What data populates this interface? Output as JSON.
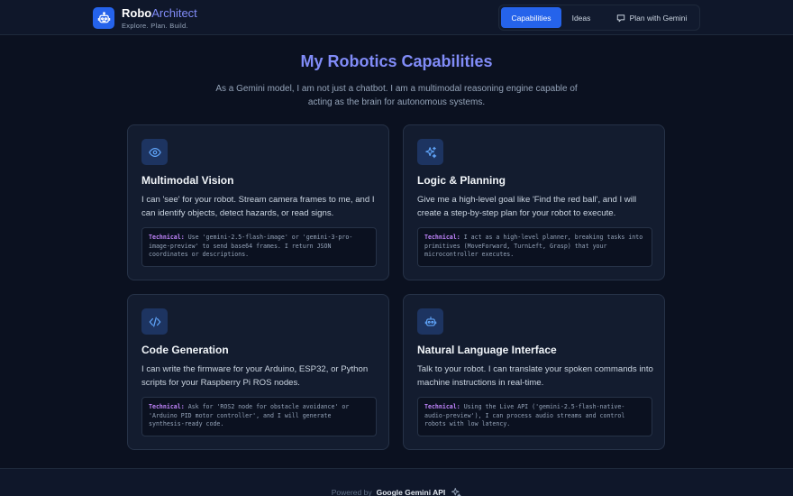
{
  "brand": {
    "name_primary": "Robo",
    "name_secondary": "Architect",
    "tagline": "Explore. Plan. Build."
  },
  "nav": {
    "items": [
      {
        "label": "Capabilities",
        "active": true
      },
      {
        "label": "Ideas",
        "active": false
      },
      {
        "label": "Plan with Gemini",
        "active": false,
        "icon": "chat-icon"
      }
    ]
  },
  "hero": {
    "title": "My Robotics Capabilities",
    "subtitle": "As a Gemini model, I am not just a chatbot. I am a multimodal reasoning engine capable of acting as the brain for autonomous systems."
  },
  "cards": [
    {
      "icon": "eye-icon",
      "title": "Multimodal Vision",
      "description": "I can 'see' for your robot. Stream camera frames to me, and I can identify objects, detect hazards, or read signs.",
      "tech_label": "Technical:",
      "tech_text": "Use 'gemini-2.5-flash-image' or 'gemini-3-pro-image-preview' to send base64 frames. I return JSON coordinates or descriptions."
    },
    {
      "icon": "sparkles-icon",
      "title": "Logic & Planning",
      "description": "Give me a high-level goal like 'Find the red ball', and I will create a step-by-step plan for your robot to execute.",
      "tech_label": "Technical:",
      "tech_text": "I act as a high-level planner, breaking tasks into primitives (MoveForward, TurnLeft, Grasp) that your microcontroller executes."
    },
    {
      "icon": "code-icon",
      "title": "Code Generation",
      "description": "I can write the firmware for your Arduino, ESP32, or Python scripts for your Raspberry Pi ROS nodes.",
      "tech_label": "Technical:",
      "tech_text": "Ask for 'ROS2 node for obstacle avoidance' or 'Arduino PID motor controller', and I will generate synthesis-ready code."
    },
    {
      "icon": "robot-icon",
      "title": "Natural Language Interface",
      "description": "Talk to your robot. I can translate your spoken commands into machine instructions in real-time.",
      "tech_label": "Technical:",
      "tech_text": "Using the Live API ('gemini-2.5-flash-native-audio-preview'), I can process audio streams and control robots with low latency."
    }
  ],
  "footer": {
    "powered_by": "Powered by",
    "api_name": "Google Gemini API"
  },
  "colors": {
    "accent": "#2563eb",
    "title": "#818cf8",
    "tech_label": "#c084fc",
    "background": "#0b1120"
  }
}
